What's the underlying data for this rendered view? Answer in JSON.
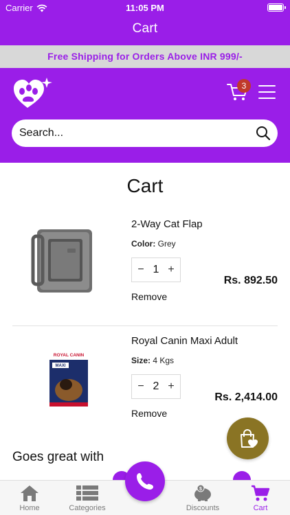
{
  "status_bar": {
    "carrier": "Carrier",
    "time": "11:05 PM"
  },
  "nav": {
    "title": "Cart"
  },
  "banner": {
    "text": "Free Shipping for Orders Above INR 999/-"
  },
  "header": {
    "cart_count": "3"
  },
  "search": {
    "placeholder": "Search..."
  },
  "page": {
    "title": "Cart"
  },
  "cart_items": [
    {
      "name": "2-Way Cat Flap",
      "attr_label": "Color:",
      "attr_value": "Grey",
      "quantity": "1",
      "price": "Rs. 892.50",
      "remove_label": "Remove",
      "minus": "−",
      "plus": "+"
    },
    {
      "name": "Royal Canin Maxi Adult",
      "attr_label": "Size:",
      "attr_value": "4 Kgs",
      "quantity": "2",
      "price": "Rs. 2,414.00",
      "remove_label": "Remove",
      "minus": "−",
      "plus": "+",
      "package_brand": "ROYAL CANIN",
      "package_label": "MAXI"
    }
  ],
  "section": {
    "goes_great_with": "Goes great with"
  },
  "tabs": {
    "home": "Home",
    "categories": "Categories",
    "discounts": "Discounts",
    "cart": "Cart"
  },
  "colors": {
    "brand": "#9a1ee8",
    "banner_bg": "#d8d8d8",
    "badge": "#c0392b",
    "fab": "#8a7424"
  },
  "icons": [
    "wifi-icon",
    "battery-icon",
    "paw-heart-logo",
    "cart-icon",
    "menu-icon",
    "search-icon",
    "shopping-bag-heart-icon",
    "phone-icon",
    "home-icon",
    "categories-icon",
    "piggy-bank-icon",
    "cart-tab-icon"
  ]
}
